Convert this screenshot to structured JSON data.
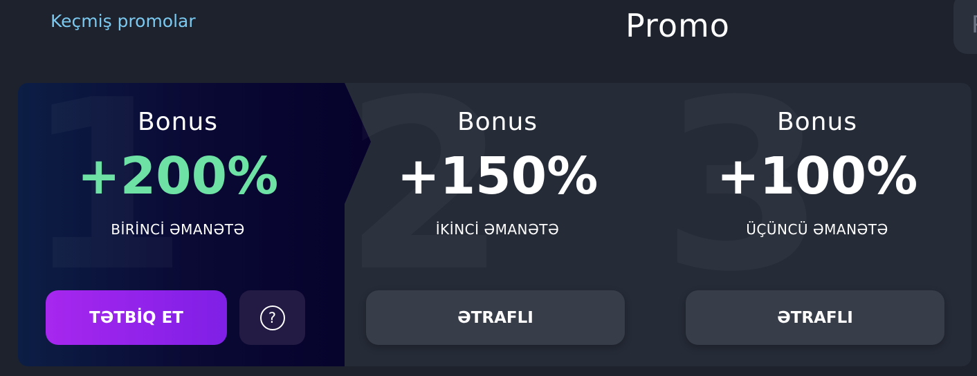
{
  "header": {
    "past_promos_link": "Keçmiş promolar",
    "title": "Promo",
    "side_tab_text": "P"
  },
  "steps": [
    {
      "number": "1",
      "label": "Bonus",
      "percent": "+200%",
      "deposit_text": "BİRİNCİ ƏMANƏTƏ",
      "active": true,
      "primary_button": "TƏTBİQ ET",
      "help_button_icon": "question-circle-icon"
    },
    {
      "number": "2",
      "label": "Bonus",
      "percent": "+150%",
      "deposit_text": "İKİNCİ ƏMANƏTƏ",
      "active": false,
      "button": "ƏTRAFLI"
    },
    {
      "number": "3",
      "label": "Bonus",
      "percent": "+100%",
      "deposit_text": "ÜÇÜNCÜ ƏMANƏTƏ",
      "active": false,
      "button": "ƏTRAFLI"
    }
  ],
  "colors": {
    "background": "#1d222d",
    "panel": "#252b37",
    "active_percent": "#6ee2a4",
    "link": "#7cc9f0",
    "apply_button": "#9224ea",
    "secondary_button": "#383d4a"
  }
}
